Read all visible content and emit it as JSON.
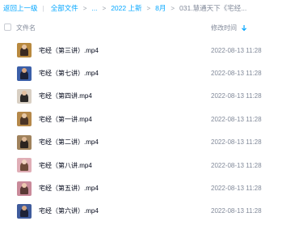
{
  "breadcrumb": {
    "back": "返回上一级",
    "items": [
      "全部文件",
      "...",
      "2022 上新",
      "8月"
    ],
    "current": "031.慧通天下《宅经..."
  },
  "header": {
    "name_label": "文件名",
    "time_label": "修改时间"
  },
  "files": [
    {
      "name": "宅经（第三讲）.mp4",
      "time": "2022-08-13 11:28",
      "thumb": {
        "bg": "#b8893f",
        "fig": "#3a2a22",
        "head": "#e4c3a4"
      }
    },
    {
      "name": "宅经（第七讲）.mp4",
      "time": "2022-08-13 11:28",
      "thumb": {
        "bg": "#3b5fa8",
        "fig": "#1c2238",
        "head": "#d9a782"
      }
    },
    {
      "name": "宅经（第四讲.mp4",
      "time": "2022-08-13 11:28",
      "thumb": {
        "bg": "#d8cfc3",
        "fig": "#2a2826",
        "head": "#e1bfa0"
      }
    },
    {
      "name": "宅经（第一讲.mp4",
      "time": "2022-08-13 11:28",
      "thumb": {
        "bg": "#b5884a",
        "fig": "#4a3426",
        "head": "#e6c8a8"
      }
    },
    {
      "name": "宅经（第二讲）.mp4",
      "time": "2022-08-13 11:28",
      "thumb": {
        "bg": "#a0825c",
        "fig": "#2b2420",
        "head": "#ddb896"
      }
    },
    {
      "name": "宅经（第八讲.mp4",
      "time": "2022-08-13 11:28",
      "thumb": {
        "bg": "#e0aeb6",
        "fig": "#6e4b3a",
        "head": "#f0d2c0"
      }
    },
    {
      "name": "宅经（第五讲）.mp4",
      "time": "2022-08-13 11:28",
      "thumb": {
        "bg": "#c98a9a",
        "fig": "#5a3a36",
        "head": "#ecc9b0"
      }
    },
    {
      "name": "宅经（第六讲）.mp4",
      "time": "2022-08-13 11:28",
      "thumb": {
        "bg": "#3f5b9c",
        "fig": "#1e2236",
        "head": "#d4a682"
      }
    }
  ]
}
